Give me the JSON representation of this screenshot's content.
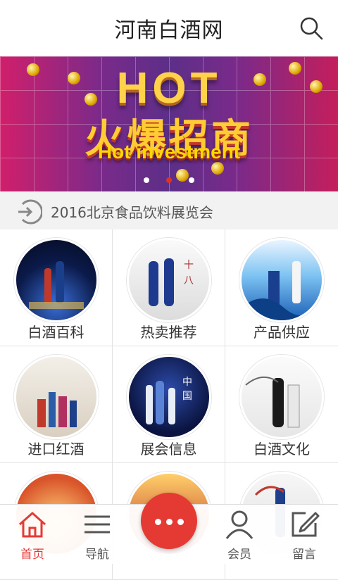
{
  "header": {
    "title": "河南白酒网"
  },
  "banner": {
    "headline": "HOT",
    "slogan": "火爆招商",
    "subline": "Hot investment"
  },
  "notice": {
    "text": "2016北京食品饮料展览会"
  },
  "tiles": [
    {
      "label": "白酒百科"
    },
    {
      "label": "热卖推荐"
    },
    {
      "label": "产品供应"
    },
    {
      "label": "进口红酒"
    },
    {
      "label": "展会信息"
    },
    {
      "label": "白酒文化"
    },
    {
      "label": ""
    },
    {
      "label": ""
    },
    {
      "label": ""
    }
  ],
  "nav": {
    "home": "首页",
    "guide": "导航",
    "member": "会员",
    "message": "留言"
  },
  "colors": {
    "accent": "#e53a34"
  }
}
